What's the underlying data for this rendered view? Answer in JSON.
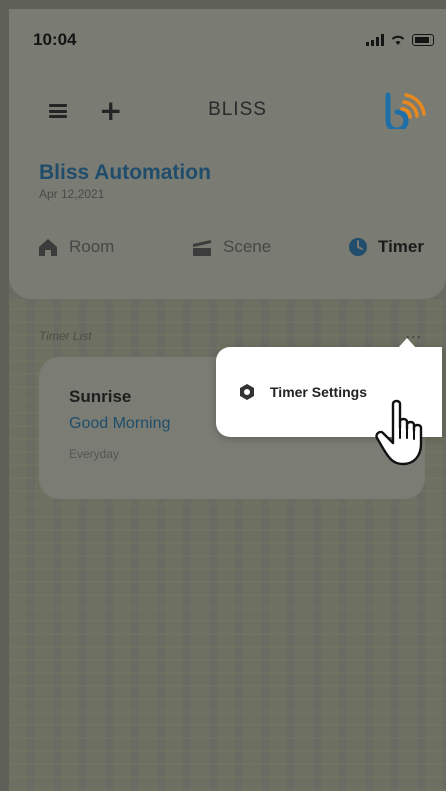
{
  "status_bar": {
    "time": "10:04"
  },
  "nav": {
    "app_title": "BLISS"
  },
  "header": {
    "title": "Bliss Automation",
    "date": "Apr 12,2021"
  },
  "tabs": [
    {
      "label": "Room",
      "icon": "home-icon",
      "active": false
    },
    {
      "label": "Scene",
      "icon": "scene-icon",
      "active": false
    },
    {
      "label": "Timer",
      "icon": "clock-icon",
      "active": true
    }
  ],
  "timer_list": {
    "label": "Timer List",
    "more": "...",
    "items": [
      {
        "name": "Sunrise",
        "subtitle": "Good Morning",
        "repeat": "Everyday"
      }
    ]
  },
  "popup_menu": {
    "items": [
      {
        "label": "Timer Settings",
        "icon": "gear-icon"
      }
    ]
  },
  "colors": {
    "accent": "#1f4d6b",
    "logo_blue": "#1e6fa8",
    "logo_orange": "#e8891f"
  }
}
